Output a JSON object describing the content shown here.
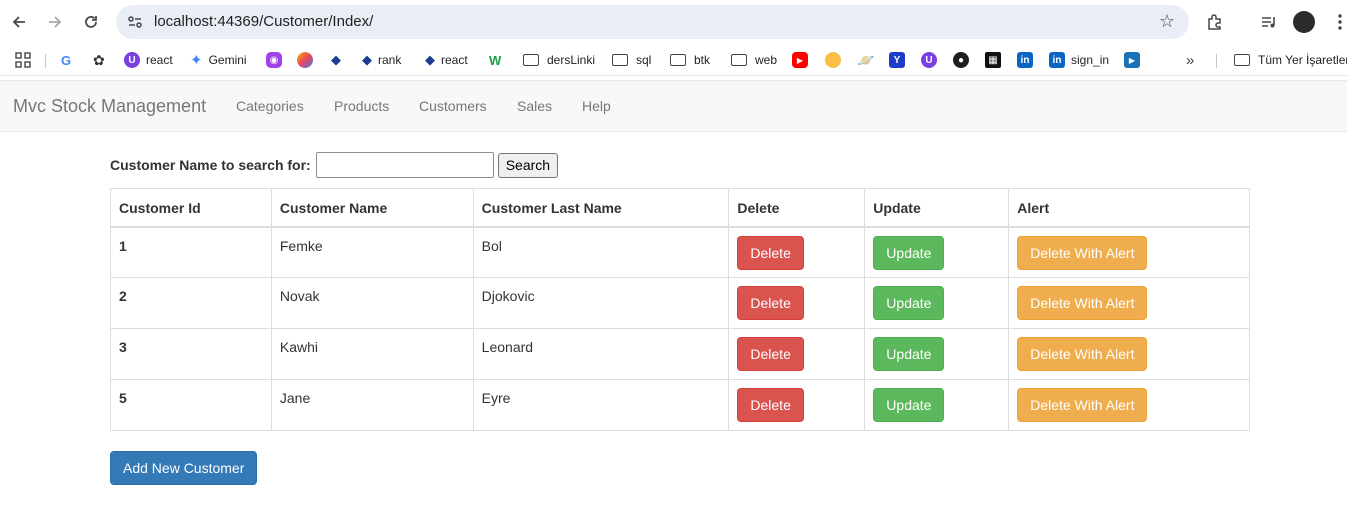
{
  "browser": {
    "url": "localhost:44369/Customer/Index/",
    "bookmarks": [
      {
        "label": "react",
        "icon": "purple-u-icon",
        "color": "#7b3fe4"
      },
      {
        "label": "Gemini",
        "icon": "gemini-icon",
        "color": "#4285f4"
      },
      {
        "label": "rank",
        "icon": "diamond-icon",
        "color": "#1a3d8f"
      },
      {
        "label": "react",
        "icon": "diamond-icon",
        "color": "#1a3d8f"
      },
      {
        "label": "dersLinki",
        "icon": "folder-icon"
      },
      {
        "label": "sql",
        "icon": "folder-icon"
      },
      {
        "label": "btk",
        "icon": "folder-icon"
      },
      {
        "label": "web",
        "icon": "folder-icon"
      },
      {
        "label": "sign_in",
        "icon": "linkedin-icon",
        "color": "#0a66c2"
      }
    ],
    "other_bookmarks": "Tüm Yer İşaretleri"
  },
  "navbar": {
    "brand": "Mvc Stock Management",
    "links": [
      "Categories",
      "Products",
      "Customers",
      "Sales",
      "Help"
    ]
  },
  "search": {
    "label": "Customer Name to search for:",
    "value": "",
    "button": "Search"
  },
  "table": {
    "headers": [
      "Customer Id",
      "Customer Name",
      "Customer Last Name",
      "Delete",
      "Update",
      "Alert"
    ],
    "rows": [
      {
        "id": "1",
        "name": "Femke",
        "last_name": "Bol",
        "delete": "Delete",
        "update": "Update",
        "alert": "Delete With Alert"
      },
      {
        "id": "2",
        "name": "Novak",
        "last_name": "Djokovic",
        "delete": "Delete",
        "update": "Update",
        "alert": "Delete With Alert"
      },
      {
        "id": "3",
        "name": "Kawhi",
        "last_name": "Leonard",
        "delete": "Delete",
        "update": "Update",
        "alert": "Delete With Alert"
      },
      {
        "id": "5",
        "name": "Jane",
        "last_name": "Eyre",
        "delete": "Delete",
        "update": "Update",
        "alert": "Delete With Alert"
      }
    ]
  },
  "add_button": "Add New Customer",
  "colors": {
    "danger": "#d9534f",
    "success": "#5cb85c",
    "warning": "#f0ad4e",
    "primary": "#337ab7"
  }
}
